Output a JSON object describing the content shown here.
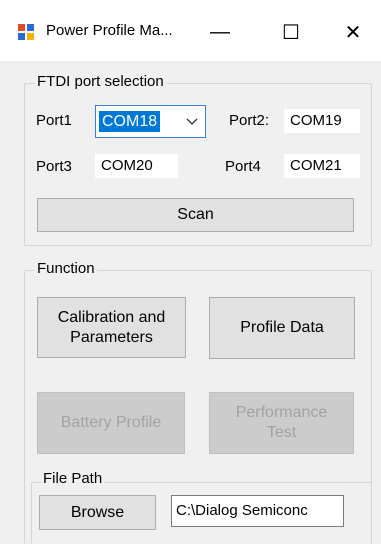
{
  "window": {
    "title": "Power Profile Ma...",
    "minimize_glyph": "—",
    "maximize_glyph": "☐",
    "close_glyph": "✕"
  },
  "ftdi": {
    "legend": "FTDI port selection",
    "port1_label": "Port1",
    "port1_value": "COM18",
    "port2_label": "Port2:",
    "port2_value": "COM19",
    "port3_label": "Port3",
    "port3_value": "COM20",
    "port4_label": "Port4",
    "port4_value": "COM21",
    "scan_label": "Scan"
  },
  "function": {
    "legend": "Function",
    "calibration_line1": "Calibration and",
    "calibration_line2": "Parameters",
    "profile_data_label": "Profile Data",
    "battery_profile_label": "Battery Profile",
    "performance_line1": "Performance",
    "performance_line2": "Test"
  },
  "file_path": {
    "legend": "File Path",
    "browse_label": "Browse",
    "path_value": "C:\\Dialog Semiconc"
  },
  "colors": {
    "accent": "#0078d7",
    "window_bg": "#f0f0f0",
    "button_bg": "#e1e1e1",
    "disabled_text": "#a2a2a2"
  },
  "icons": {
    "app": "app-window-icon",
    "dropdown": "chevron-down-icon"
  }
}
